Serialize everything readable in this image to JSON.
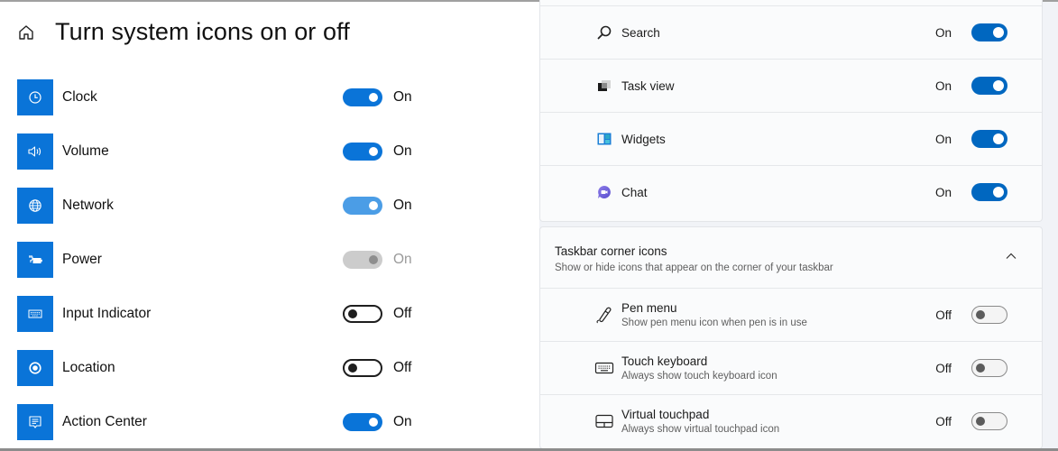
{
  "left_panel": {
    "title": "Turn system icons on or off",
    "home_icon": "home-icon",
    "items": [
      {
        "label": "Clock",
        "icon": "clock-icon",
        "state": "On",
        "toggle": "on"
      },
      {
        "label": "Volume",
        "icon": "volume-icon",
        "state": "On",
        "toggle": "on"
      },
      {
        "label": "Network",
        "icon": "network-globe-icon",
        "state": "On",
        "toggle": "light"
      },
      {
        "label": "Power",
        "icon": "power-plug-battery-icon",
        "state": "On",
        "toggle": "disabled"
      },
      {
        "label": "Input Indicator",
        "icon": "keyboard-icon",
        "state": "Off",
        "toggle": "off"
      },
      {
        "label": "Location",
        "icon": "location-icon",
        "state": "Off",
        "toggle": "off"
      },
      {
        "label": "Action Center",
        "icon": "action-center-icon",
        "state": "On",
        "toggle": "on"
      }
    ],
    "accent_color": "#0a74d8"
  },
  "right_panel": {
    "taskbar_items": [
      {
        "label": "Search",
        "icon": "search-icon",
        "state": "On"
      },
      {
        "label": "Task view",
        "icon": "task-view-icon",
        "state": "On"
      },
      {
        "label": "Widgets",
        "icon": "widgets-icon",
        "state": "On"
      },
      {
        "label": "Chat",
        "icon": "chat-icon",
        "state": "On"
      }
    ],
    "corner_section": {
      "title": "Taskbar corner icons",
      "subtitle": "Show or hide icons that appear on the corner of your taskbar",
      "expanded": true,
      "items": [
        {
          "label": "Pen menu",
          "description": "Show pen menu icon when pen is in use",
          "icon": "pen-icon",
          "state": "Off"
        },
        {
          "label": "Touch keyboard",
          "description": "Always show touch keyboard icon",
          "icon": "touch-keyboard-icon",
          "state": "Off"
        },
        {
          "label": "Virtual touchpad",
          "description": "Always show virtual touchpad icon",
          "icon": "touchpad-icon",
          "state": "Off"
        }
      ]
    },
    "accent_color": "#0067c0"
  }
}
